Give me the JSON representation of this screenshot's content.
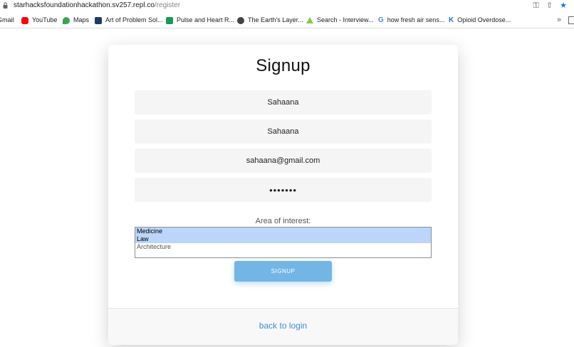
{
  "browser": {
    "url_host": "starhacksfoundationhackathon.sv257.repl.co",
    "url_path": "/register",
    "icons": [
      "key-icon",
      "share-icon",
      "star-icon"
    ]
  },
  "bookmarks": [
    {
      "label": "Gmail",
      "icon": "gmail-icon",
      "color": "#ea4335"
    },
    {
      "label": "YouTube",
      "icon": "youtube-icon",
      "color": "#ff0000"
    },
    {
      "label": "Maps",
      "icon": "maps-icon",
      "color": "#34a853"
    },
    {
      "label": "Art of Problem Sol...",
      "icon": "aops-icon",
      "color": "#1f3c66"
    },
    {
      "label": "Pulse and Heart R...",
      "icon": "pulse-icon",
      "color": "#0f9d58"
    },
    {
      "label": "The Earth's Layer...",
      "icon": "globe-icon",
      "color": "#444444"
    },
    {
      "label": "Search - Interview...",
      "icon": "search-icon",
      "color": "#8bc34a"
    },
    {
      "label": "how fresh air sens...",
      "icon": "google-icon",
      "color": "#4285f4"
    },
    {
      "label": "Opioid Overdose...",
      "icon": "k-icon",
      "color": "#1a73e8"
    }
  ],
  "bookmarks_more": "»",
  "form": {
    "title": "Signup",
    "first_name": "Sahaana",
    "last_name": "Sahaana",
    "email": "sahaana@gmail.com",
    "password": "•••••••",
    "area_label": "Area of interest:",
    "areas": [
      {
        "label": "Medicine",
        "selected": true
      },
      {
        "label": "Law",
        "selected": true
      },
      {
        "label": "Architecture",
        "selected": false
      }
    ],
    "signup_label": "SIGNUP",
    "back_label": "back to login"
  },
  "colors": {
    "accent": "#73b6e6",
    "link": "#3d8fd6",
    "selected": "#bcd6fb"
  }
}
